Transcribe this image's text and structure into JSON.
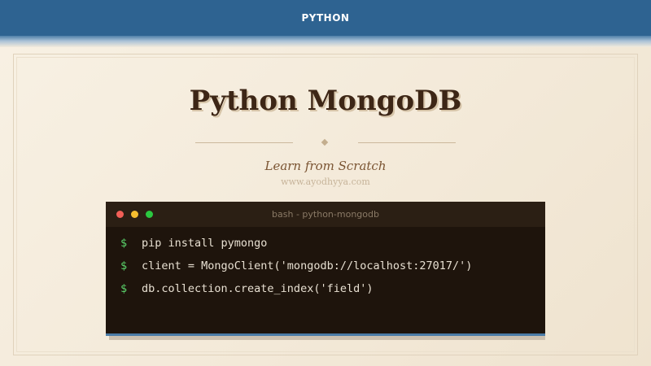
{
  "header": {
    "category": "PYTHON"
  },
  "hero": {
    "title": "Python MongoDB",
    "subtitle": "Learn from Scratch",
    "website": "www.ayodhyya.com"
  },
  "terminal": {
    "window_title": "bash - python-mongodb",
    "prompt_symbol": "$",
    "lines": [
      "pip install pymongo",
      "client = MongoClient('mongodb://localhost:27017/')",
      "db.collection.create_index('field')"
    ]
  },
  "colors": {
    "header_bg": "#2e6391",
    "title": "#3d2616",
    "terminal_bg": "#1e140c",
    "prompt": "#5bd36b"
  }
}
